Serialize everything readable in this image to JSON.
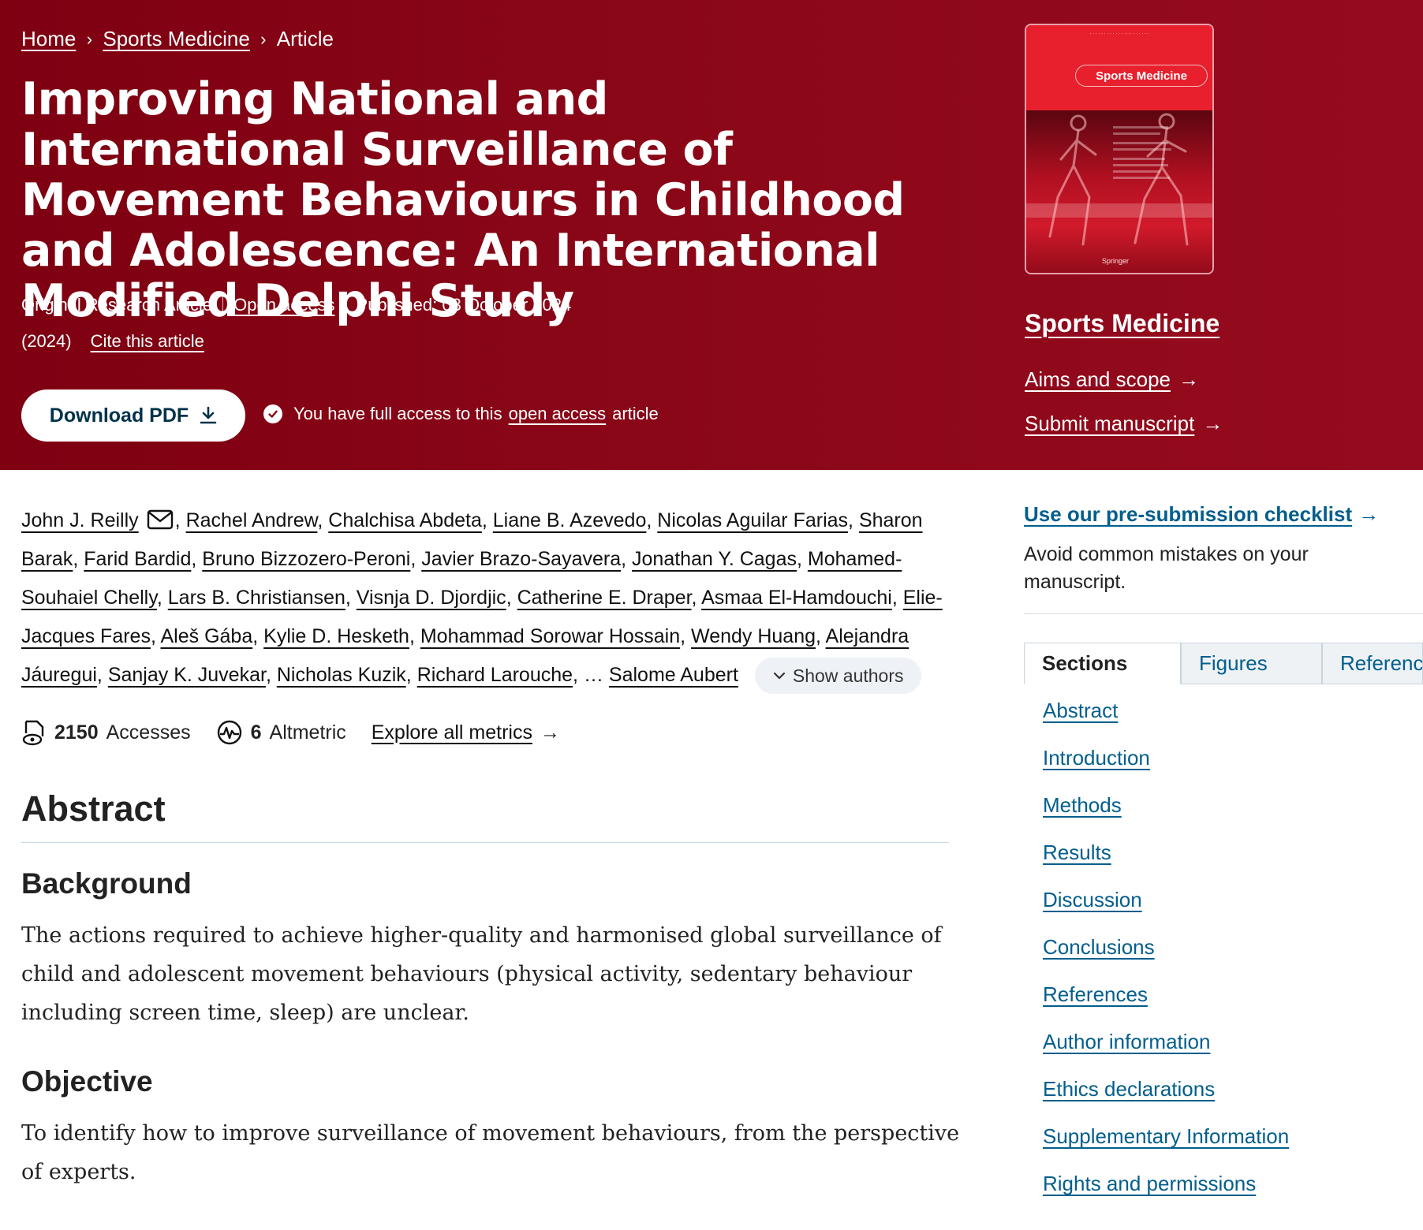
{
  "breadcrumb": {
    "home": "Home",
    "journal": "Sports Medicine",
    "current": "Article"
  },
  "article": {
    "title": "Improving National and International Surveillance of Movement Behaviours in Childhood and Adolescence: An International Modified Delphi Study",
    "type": "Original Research Article",
    "open_access": "Open access",
    "published": "Published: 03 October 2024",
    "year": "(2024)",
    "cite": "Cite this article",
    "download_pdf": "Download PDF",
    "access_prefix": "You have full access to this",
    "access_link": "open access",
    "access_suffix": "article"
  },
  "journal": {
    "cover_title": "Sports Medicine",
    "cover_publisher": "Springer",
    "name": "Sports Medicine",
    "aims": "Aims and scope",
    "submit": "Submit manuscript"
  },
  "authors": {
    "list": [
      "John J. Reilly",
      "Rachel Andrew",
      "Chalchisa Abdeta",
      "Liane B. Azevedo",
      "Nicolas Aguilar Farias",
      "Sharon Barak",
      "Farid Bardid",
      "Bruno Bizzozero-Peroni",
      "Javier Brazo-Sayavera",
      "Jonathan Y. Cagas",
      "Mohamed-Souhaiel Chelly",
      "Lars B. Christiansen",
      "Visnja D. Djordjic",
      "Catherine E. Draper",
      "Asmaa El-Hamdouchi",
      "Elie-Jacques Fares",
      "Aleš Gába",
      "Kylie D. Hesketh",
      "Mohammad Sorowar Hossain",
      "Wendy Huang",
      "Alejandra Jáuregui",
      "Sanjay K. Juvekar",
      "Nicholas Kuzik",
      "Richard Larouche"
    ],
    "ellipsis": "…",
    "last": "Salome Aubert",
    "show_authors": "Show authors"
  },
  "metrics": {
    "accesses_count": "2150",
    "accesses_label": "Accesses",
    "altmetric_count": "6",
    "altmetric_label": "Altmetric",
    "explore": "Explore all metrics"
  },
  "abstract": {
    "heading": "Abstract",
    "background_heading": "Background",
    "background_text": "The actions required to achieve higher-quality and harmonised global surveillance of child and adolescent movement behaviours (physical activity, sedentary behaviour including screen time, sleep) are unclear.",
    "objective_heading": "Objective",
    "objective_text": "To identify how to improve surveillance of movement behaviours, from the perspective of experts."
  },
  "rail": {
    "checklist_link": "Use our pre-submission checklist",
    "checklist_desc": "Avoid common mistakes on your manuscript.",
    "tabs": [
      "Sections",
      "Figures",
      "References"
    ],
    "sections": [
      "Abstract",
      "Introduction",
      "Methods",
      "Results",
      "Discussion",
      "Conclusions",
      "References",
      "Author information",
      "Ethics declarations",
      "Supplementary Information",
      "Rights and permissions"
    ]
  },
  "colors": {
    "hero_bg": "#8a0718",
    "link_blue": "#025e8d",
    "pdf_text": "#01324b"
  }
}
